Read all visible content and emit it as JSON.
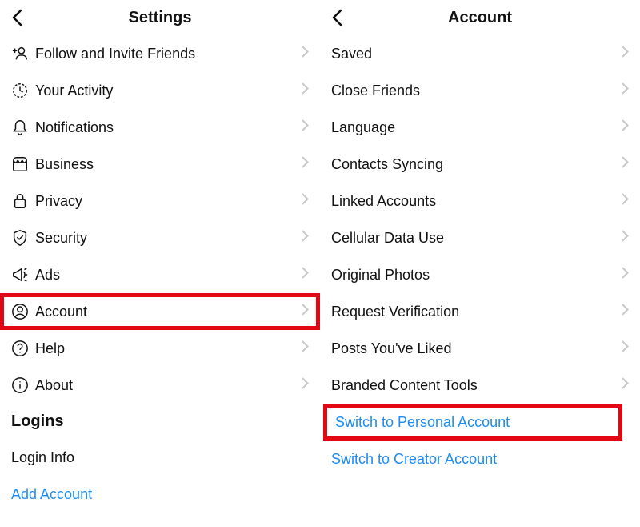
{
  "left": {
    "title": "Settings",
    "items": [
      {
        "icon": "follow-invite-icon",
        "label": "Follow and Invite Friends",
        "hasChevron": true
      },
      {
        "icon": "activity-icon",
        "label": "Your Activity",
        "hasChevron": true
      },
      {
        "icon": "notifications-icon",
        "label": "Notifications",
        "hasChevron": true
      },
      {
        "icon": "business-icon",
        "label": "Business",
        "hasChevron": true
      },
      {
        "icon": "privacy-icon",
        "label": "Privacy",
        "hasChevron": true
      },
      {
        "icon": "security-icon",
        "label": "Security",
        "hasChevron": true
      },
      {
        "icon": "ads-icon",
        "label": "Ads",
        "hasChevron": true
      },
      {
        "icon": "account-icon",
        "label": "Account",
        "hasChevron": true,
        "highlight": true
      },
      {
        "icon": "help-icon",
        "label": "Help",
        "hasChevron": true
      },
      {
        "icon": "about-icon",
        "label": "About",
        "hasChevron": true
      }
    ],
    "sectionTitle": "Logins",
    "loginItems": [
      {
        "label": "Login Info",
        "link": false
      },
      {
        "label": "Add Account",
        "link": true
      }
    ]
  },
  "right": {
    "title": "Account",
    "items": [
      {
        "label": "Saved",
        "hasChevron": true
      },
      {
        "label": "Close Friends",
        "hasChevron": true
      },
      {
        "label": "Language",
        "hasChevron": true
      },
      {
        "label": "Contacts Syncing",
        "hasChevron": true
      },
      {
        "label": "Linked Accounts",
        "hasChevron": true
      },
      {
        "label": "Cellular Data Use",
        "hasChevron": true
      },
      {
        "label": "Original Photos",
        "hasChevron": true
      },
      {
        "label": "Request Verification",
        "hasChevron": true
      },
      {
        "label": "Posts You've Liked",
        "hasChevron": true
      },
      {
        "label": "Branded Content Tools",
        "hasChevron": true
      },
      {
        "label": "Switch to Personal Account",
        "hasChevron": false,
        "link": true,
        "highlight": true
      },
      {
        "label": "Switch to Creator Account",
        "hasChevron": false,
        "link": true
      }
    ]
  }
}
